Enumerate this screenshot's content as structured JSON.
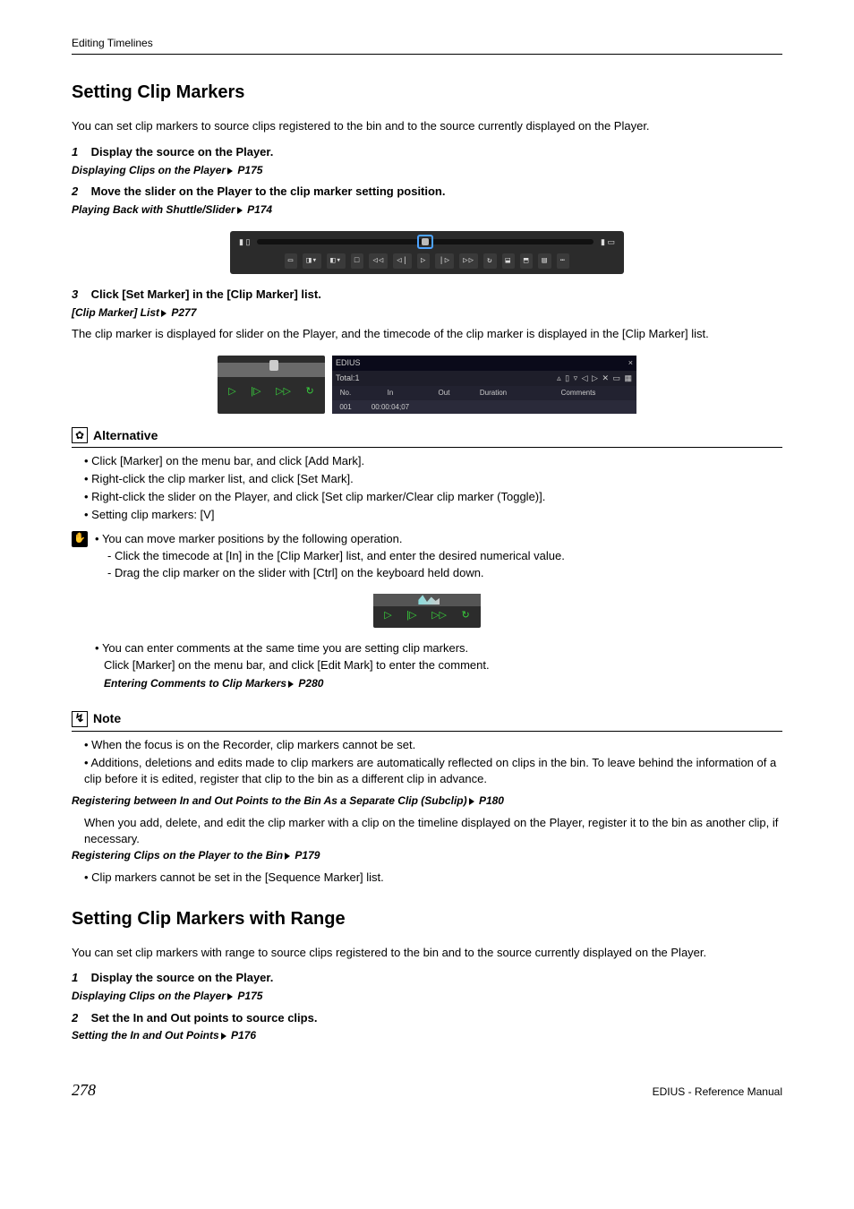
{
  "header": {
    "section": "Editing Timelines"
  },
  "h1": "Setting Clip Markers",
  "intro1": "You can set clip markers to source clips registered to the bin and to the source currently displayed on the Player.",
  "steps1": {
    "s1": {
      "n": "1",
      "t": "Display the source on the Player."
    },
    "x1": {
      "label": "Displaying Clips on the Player",
      "page": "P175"
    },
    "s2": {
      "n": "2",
      "t": "Move the slider on the Player to the clip marker setting position."
    },
    "x2": {
      "label": "Playing Back with Shuttle/Slider",
      "page": "P174"
    },
    "s3": {
      "n": "3",
      "t": "Click [Set Marker] in the [Clip Marker] list."
    },
    "x3": {
      "label": "[Clip Marker] List",
      "page": "P277"
    },
    "after3": "The clip marker is displayed for slider on the Player, and the timecode of the clip marker is displayed in the [Clip Marker] list."
  },
  "fig2": {
    "title": "EDIUS",
    "close": "×",
    "tab": "Total:1",
    "iconstrip": "▵ ▯ ▿ ◁ ▷ ✕ ▭ ▦",
    "cols": {
      "no": "No.",
      "in": "In",
      "out": "Out",
      "dur": "Duration",
      "com": "Comments"
    },
    "row": {
      "no": "001",
      "in": "00:00:04;07",
      "out": "",
      "dur": "",
      "com": ""
    },
    "btns": {
      "play": "▷",
      "pn": "|▷",
      "ff": "▷▷",
      "loop": "↻"
    }
  },
  "alt": {
    "title": "Alternative",
    "items": [
      "Click [Marker] on the menu bar, and click [Add Mark].",
      "Right-click the clip marker list, and click [Set Mark].",
      "Right-click the slider on the Player, and click [Set clip marker/Clear clip marker (Toggle)].",
      "Setting clip markers: [V]"
    ]
  },
  "info1": {
    "lead": "You can move marker positions by the following operation.",
    "dashes": [
      "Click the timecode at [In] in the [Clip Marker] list, and enter the desired numerical value.",
      "Drag the clip marker on the slider with [Ctrl] on the keyboard held down."
    ]
  },
  "info2": {
    "lead": "You can enter comments at the same time you are setting clip markers.",
    "line2": "Click [Marker] on the menu bar, and click [Edit Mark] to enter the comment.",
    "xref": {
      "label": "Entering Comments to Clip Markers",
      "page": "P280"
    }
  },
  "note": {
    "title": "Note",
    "b1": "When the focus is on the Recorder, clip markers cannot be set.",
    "b2": "Additions, deletions and edits made to clip markers are automatically reflected on clips in the bin. To leave behind the information of a clip before it is edited, register that clip to the bin as a different clip in advance.",
    "x1": {
      "label": "Registering between In and Out Points to the Bin As a Separate Clip (Subclip)",
      "page": "P180"
    },
    "b2cont": "When you add, delete, and edit the clip marker with a clip on the timeline displayed on the Player, register it to the bin as another clip, if necessary.",
    "x2": {
      "label": "Registering Clips on the Player to the Bin",
      "page": "P179"
    },
    "b3": "Clip markers cannot be set in the [Sequence Marker] list."
  },
  "h2": "Setting Clip Markers with Range",
  "intro2": "You can set clip markers with range to source clips registered to the bin and to the source currently displayed on the Player.",
  "steps2": {
    "s1": {
      "n": "1",
      "t": "Display the source on the Player."
    },
    "x1": {
      "label": "Displaying Clips on the Player",
      "page": "P175"
    },
    "s2": {
      "n": "2",
      "t": "Set the In and Out points to source clips."
    },
    "x2": {
      "label": "Setting the In and Out Points",
      "page": "P176"
    }
  },
  "footer": {
    "page": "278",
    "doc": "EDIUS - Reference Manual"
  }
}
